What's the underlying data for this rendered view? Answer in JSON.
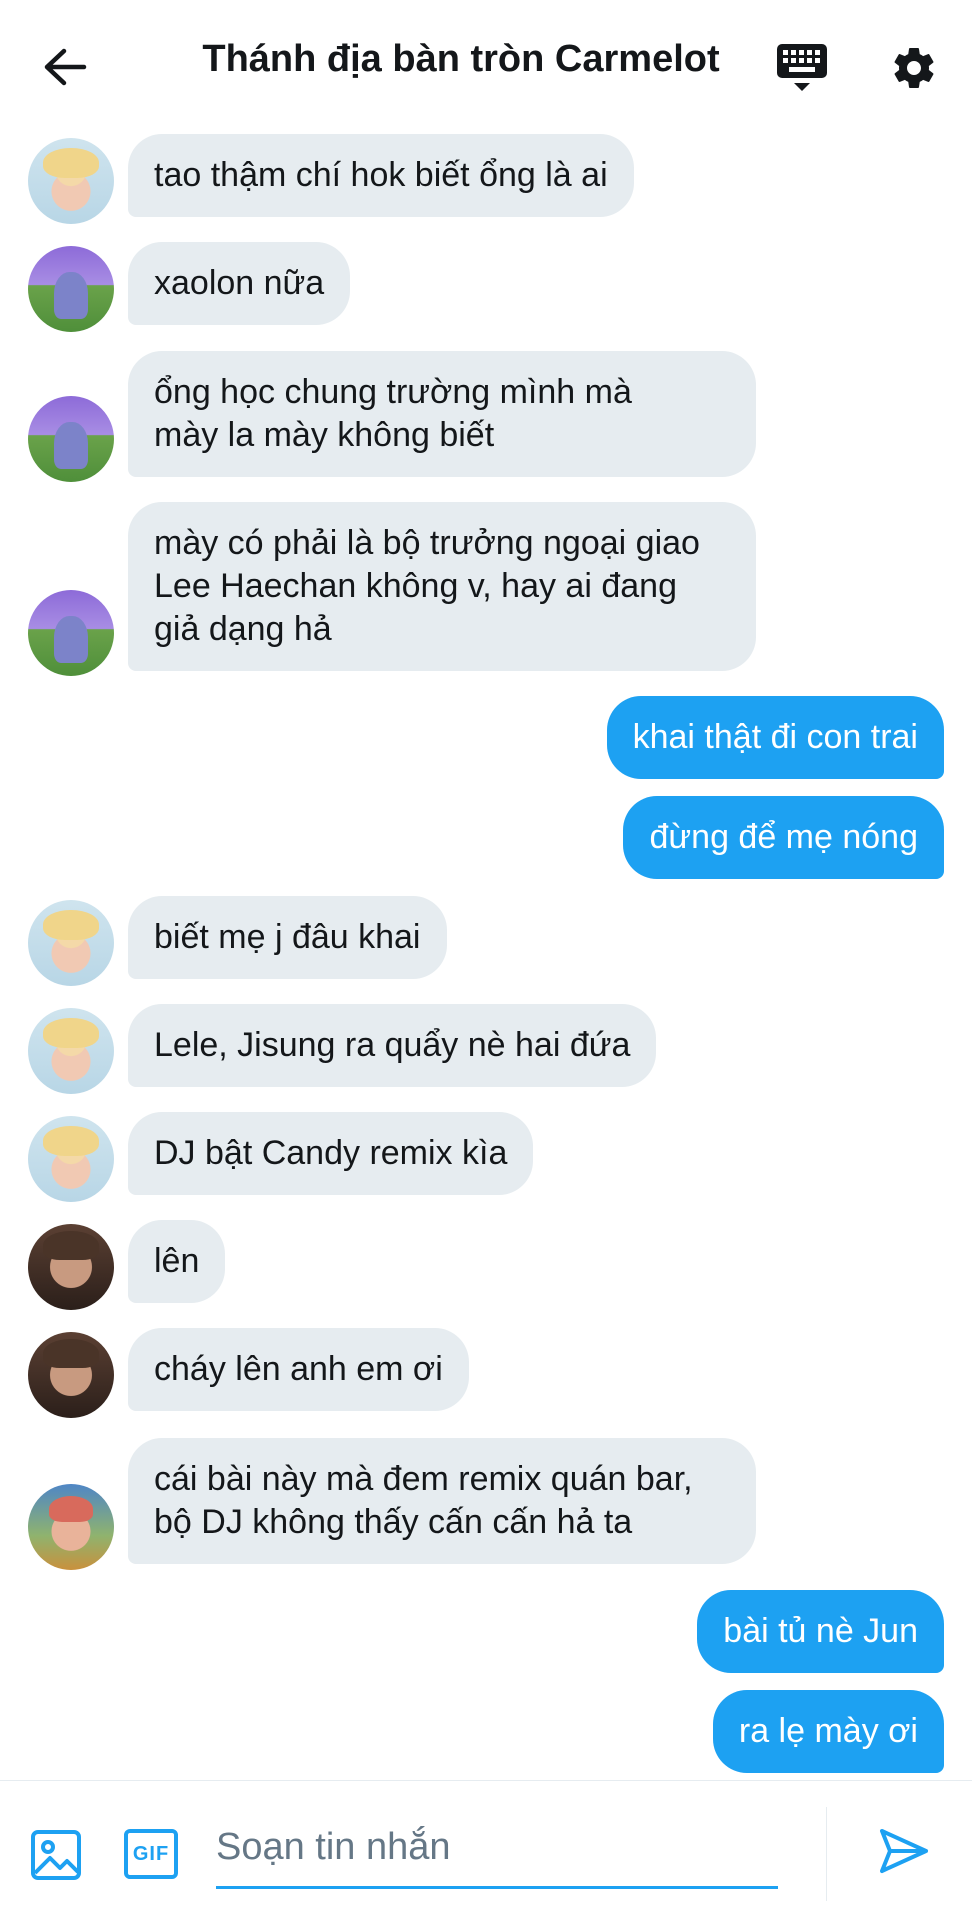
{
  "header": {
    "title": "Thánh địa bàn tròn Carmelot",
    "back_icon": "arrow-left-icon",
    "keyboard_icon": "keyboard-icon",
    "settings_icon": "gear-icon"
  },
  "colors": {
    "accent": "#1da1f2",
    "incoming_bubble": "#e6ecf0",
    "text": "#14171a",
    "placeholder": "#657786"
  },
  "messages": [
    {
      "direction": "in",
      "avatar": "blond",
      "text": "tao thậm chí hok biết ổng là ai"
    },
    {
      "direction": "in",
      "avatar": "field",
      "text": "xaolon nữa"
    },
    {
      "direction": "in",
      "avatar": "field",
      "lines": [
        "ổng học chung trường mình mà",
        "mày la mày không biết"
      ]
    },
    {
      "direction": "in",
      "avatar": "field",
      "lines": [
        "mày có phải là bộ trưởng ngoại giao",
        "Lee Haechan không v, hay ai đang",
        "giả dạng hả"
      ]
    },
    {
      "direction": "out",
      "text": "khai thật đi con trai"
    },
    {
      "direction": "out",
      "text": "đừng để mẹ nóng"
    },
    {
      "direction": "in",
      "avatar": "blond",
      "text": "biết mẹ j đâu khai"
    },
    {
      "direction": "in",
      "avatar": "blond",
      "text": "Lele, Jisung ra quẩy nè hai đứa"
    },
    {
      "direction": "in",
      "avatar": "blond",
      "text": "DJ bật Candy remix kìa"
    },
    {
      "direction": "in",
      "avatar": "dark",
      "text": "lên"
    },
    {
      "direction": "in",
      "avatar": "dark",
      "text": "cháy lên anh em ơi"
    },
    {
      "direction": "in",
      "avatar": "sunset",
      "lines": [
        "cái bài này mà đem remix quán bar,",
        "bộ DJ không thấy cấn cấn hả ta"
      ]
    },
    {
      "direction": "out",
      "text": "bài tủ nè Jun"
    },
    {
      "direction": "out",
      "text": "ra lẹ mày ơi"
    }
  ],
  "composer": {
    "placeholder": "Soạn tin nhắn",
    "value": "",
    "gif_label": "GIF",
    "image_icon": "image-icon",
    "send_icon": "send-icon"
  }
}
